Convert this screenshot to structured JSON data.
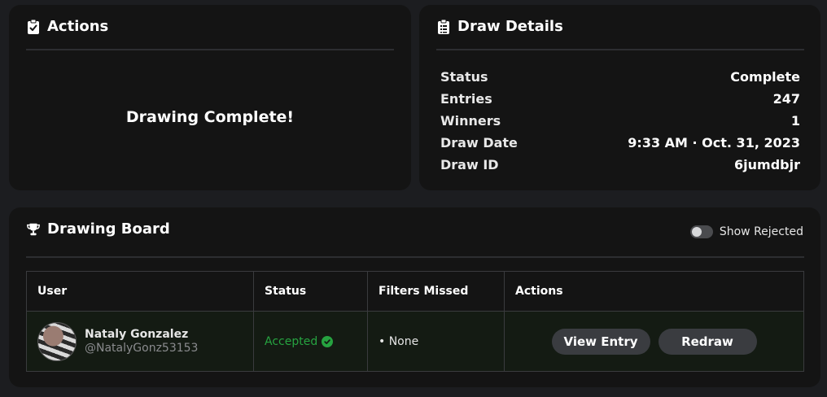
{
  "actions": {
    "title": "Actions",
    "icon": "clipboard-check-icon",
    "message": "Drawing Complete!"
  },
  "details": {
    "title": "Draw Details",
    "icon": "clipboard-list-icon",
    "rows": [
      {
        "key": "Status",
        "value": "Complete"
      },
      {
        "key": "Entries",
        "value": "247"
      },
      {
        "key": "Winners",
        "value": "1"
      },
      {
        "key": "Draw Date",
        "value": "9:33 AM · Oct. 31, 2023"
      },
      {
        "key": "Draw ID",
        "value": "6jumdbjr"
      }
    ]
  },
  "board": {
    "title": "Drawing Board",
    "icon": "trophy-icon",
    "toggle_label": "Show Rejected",
    "toggle_on": false,
    "columns": [
      "User",
      "Status",
      "Filters Missed",
      "Actions"
    ],
    "rows": [
      {
        "name": "Nataly Gonzalez",
        "handle": "@NatalyGonz53153",
        "status": "Accepted",
        "filters": "• None",
        "view_label": "View Entry",
        "redraw_label": "Redraw"
      }
    ]
  },
  "colors": {
    "background": "#1c1d20",
    "panel": "#141414",
    "accepted": "#26a340",
    "button": "#3a3c40"
  }
}
